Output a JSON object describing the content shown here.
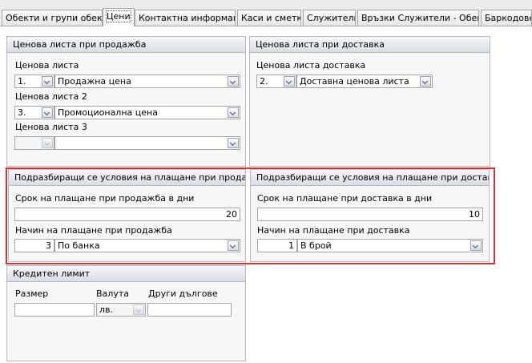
{
  "tabs": [
    {
      "label": "Обекти и групи обекти",
      "active": false
    },
    {
      "label": "Цени",
      "active": true
    },
    {
      "label": "Контактна информация",
      "active": false
    },
    {
      "label": "Каси и сметки",
      "active": false
    },
    {
      "label": "Служители",
      "active": false
    },
    {
      "label": "Връзки Служители - Обекти",
      "active": false
    },
    {
      "label": "Баркодове",
      "active": false
    }
  ],
  "sale_price_lists": {
    "title": "Ценова листа при продажба",
    "fields": [
      {
        "label": "Ценова листа",
        "number": "1.",
        "name": "Продажна цена"
      },
      {
        "label": "Ценова листа 2",
        "number": "3.",
        "name": "Промоционална цена"
      },
      {
        "label": "Ценова листа 3",
        "number": "",
        "name": ""
      }
    ]
  },
  "delivery_price_list": {
    "title": "Ценова листа при доставка",
    "label": "Ценова листа доставка",
    "number": "2.",
    "name": "Доставна ценова листа"
  },
  "sale_payment_terms": {
    "title": "Подразбиращи се условия на плащане при продажба",
    "term_label": "Срок на плащане при продажба в дни",
    "term_value": "20",
    "method_label": "Начин на плащане при продажба",
    "method_code": "3",
    "method_name": "По банка"
  },
  "delivery_payment_terms": {
    "title": "Подразбиращи се условия на плащане при доставка",
    "term_label": "Срок на плащане при доставка в дни",
    "term_value": "10",
    "method_label": "Начин на плащане при доставка",
    "method_code": "1",
    "method_name": "В брой"
  },
  "credit_limit": {
    "title": "Кредитен лимит",
    "size_label": "Размер",
    "size_value": "",
    "currency_label": "Валута",
    "currency_value": "лв.",
    "other_debts_label": "Други дългове",
    "other_debts_value": ""
  },
  "colors": {
    "highlight": "#d83131",
    "panel_border": "#b4b9c3"
  }
}
